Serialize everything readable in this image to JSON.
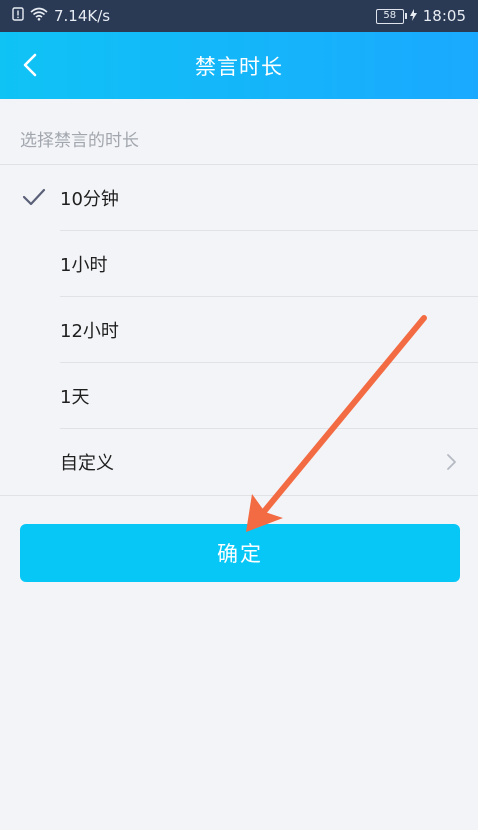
{
  "status_bar": {
    "network_speed": "7.14K/s",
    "battery": "58",
    "time": "18:05"
  },
  "header": {
    "title": "禁言时长"
  },
  "subtitle": "选择禁言的时长",
  "options": [
    {
      "label": "10分钟",
      "selected": true
    },
    {
      "label": "1小时"
    },
    {
      "label": "12小时"
    },
    {
      "label": "1天"
    },
    {
      "label": "自定义",
      "has_chevron": true
    }
  ],
  "confirm_button": {
    "label": "确定"
  },
  "colors": {
    "header_start": "#0fc3f5",
    "header_end": "#1aa9ff",
    "button": "#07c7f7",
    "annotation_arrow": "#f26b43"
  }
}
